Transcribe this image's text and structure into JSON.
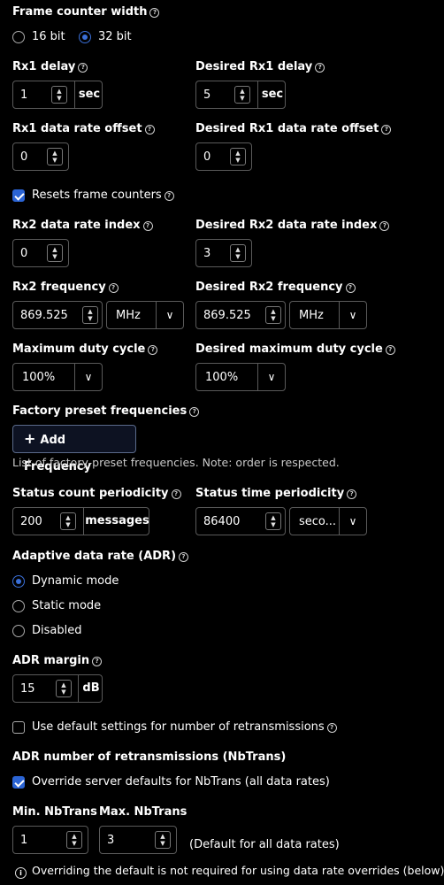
{
  "frame_counter": {
    "label": "Frame counter width",
    "options": [
      "16 bit",
      "32 bit"
    ],
    "selected": "32 bit"
  },
  "rx1_delay": {
    "label": "Rx1 delay",
    "value": "1",
    "unit": "sec"
  },
  "desired_rx1_delay": {
    "label": "Desired Rx1 delay",
    "value": "5",
    "unit": "sec"
  },
  "rx1_dr_offset": {
    "label": "Rx1 data rate offset",
    "value": "0"
  },
  "desired_rx1_dr_offset": {
    "label": "Desired Rx1 data rate offset",
    "value": "0"
  },
  "resets_frame_counters": {
    "label": "Resets frame counters",
    "checked": true
  },
  "rx2_dr_index": {
    "label": "Rx2 data rate index",
    "value": "0"
  },
  "desired_rx2_dr_index": {
    "label": "Desired Rx2 data rate index",
    "value": "3"
  },
  "rx2_frequency": {
    "label": "Rx2 frequency",
    "value": "869.525",
    "unit": "MHz"
  },
  "desired_rx2_frequency": {
    "label": "Desired Rx2 frequency",
    "value": "869.525",
    "unit": "MHz"
  },
  "max_duty_cycle": {
    "label": "Maximum duty cycle",
    "value": "100%"
  },
  "desired_max_duty_cycle": {
    "label": "Desired maximum duty cycle",
    "value": "100%"
  },
  "factory_preset": {
    "label": "Factory preset frequencies",
    "button_label": "Add Frequency",
    "hint": "List of factory-preset frequencies. Note: order is respected."
  },
  "status_count": {
    "label": "Status count periodicity",
    "value": "200",
    "unit": "messages"
  },
  "status_time": {
    "label": "Status time periodicity",
    "value": "86400",
    "unit": "seco..."
  },
  "adr": {
    "label": "Adaptive data rate (ADR)",
    "options": [
      "Dynamic mode",
      "Static mode",
      "Disabled"
    ],
    "selected": "Dynamic mode"
  },
  "adr_margin": {
    "label": "ADR margin",
    "value": "15",
    "unit": "dB"
  },
  "use_default_retrans": {
    "label": "Use default settings for number of retransmissions",
    "checked": false
  },
  "nbtrans": {
    "heading": "ADR number of retransmissions (NbTrans)",
    "override_label": "Override server defaults for NbTrans (all data rates)",
    "override_checked": true,
    "min_label": "Min. NbTrans",
    "min_value": "1",
    "max_label": "Max. NbTrans",
    "max_value": "3",
    "default_note": "(Default for all data rates)"
  },
  "info_note": "Overriding the default is not required for using data rate overrides (below)",
  "colors": {
    "accent": "#2b64d4",
    "background": "#000000",
    "border": "#5a5a5a"
  }
}
